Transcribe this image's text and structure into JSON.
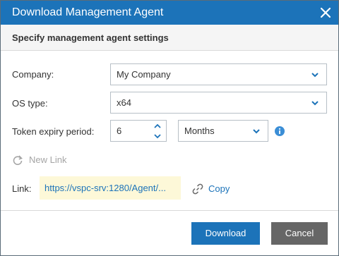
{
  "dialog": {
    "title": "Download Management Agent",
    "subtitle": "Specify management agent settings"
  },
  "form": {
    "company": {
      "label": "Company:",
      "value": "My Company"
    },
    "os_type": {
      "label": "OS type:",
      "value": "x64"
    },
    "token_expiry": {
      "label": "Token expiry period:",
      "value": "6",
      "unit": "Months"
    }
  },
  "new_link": {
    "label": "New Link"
  },
  "link": {
    "label": "Link:",
    "value": "https://vspc-srv:1280/Agent/..."
  },
  "copy": {
    "label": "Copy"
  },
  "buttons": {
    "download": "Download",
    "cancel": "Cancel"
  },
  "colors": {
    "accent": "#1c73b9",
    "title_bar": "#1c73b9",
    "link_bg": "#fdf8d8",
    "cancel_bg": "#666666"
  },
  "icons": {
    "close": "close-icon",
    "chevron": "chevron-down-icon",
    "spinner": "spinner-arrows-icon",
    "info": "info-icon",
    "refresh": "refresh-icon",
    "copy": "link-icon"
  }
}
